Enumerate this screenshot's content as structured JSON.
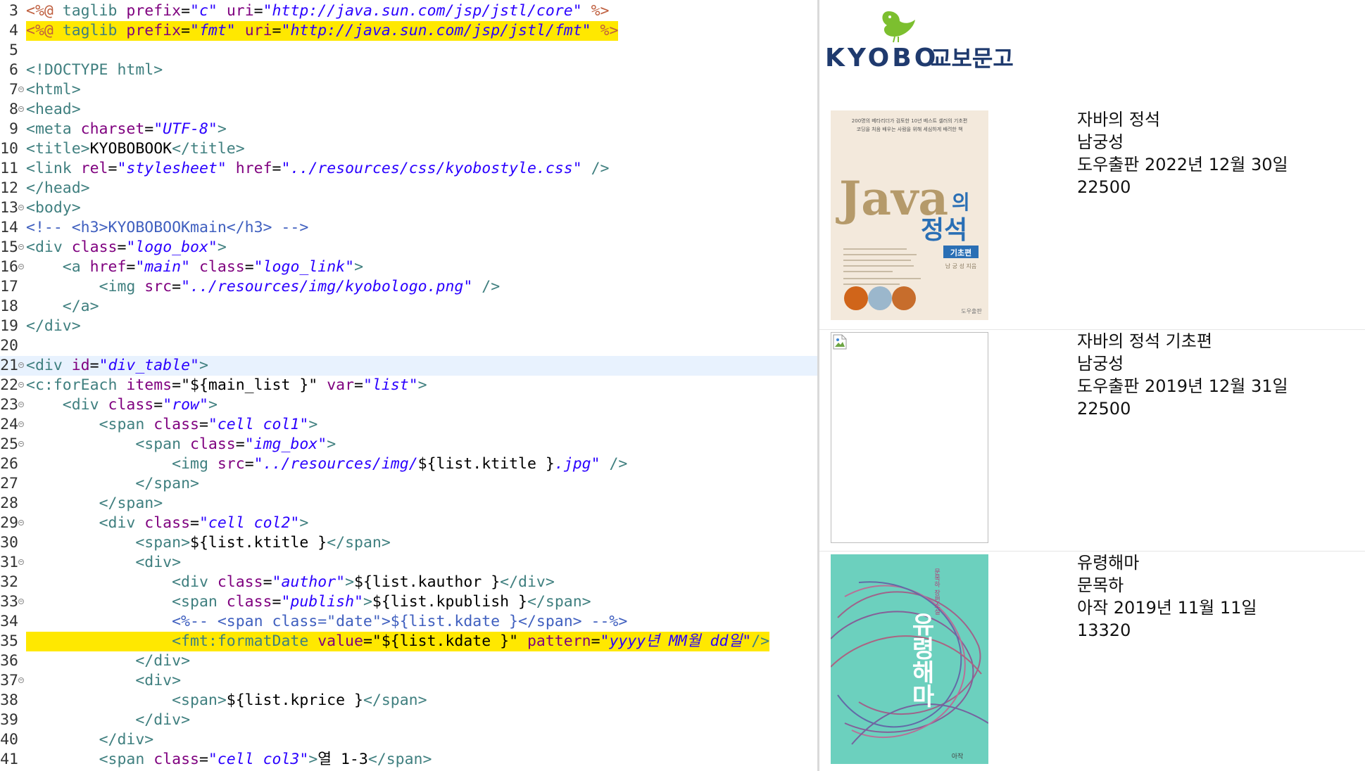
{
  "editor": {
    "current_line": 21,
    "lines": [
      {
        "n": "3",
        "fold": false,
        "hl": false,
        "tokens": [
          [
            "dir",
            "<%@ "
          ],
          [
            "tag",
            "taglib "
          ],
          [
            "attr",
            "prefix"
          ],
          [
            "txt",
            "="
          ],
          [
            "val",
            "\"c\""
          ],
          [
            "txt",
            " "
          ],
          [
            "attr",
            "uri"
          ],
          [
            "txt",
            "="
          ],
          [
            "val",
            "\"http://java.sun.com/jsp/jstl/core\""
          ],
          [
            "dir",
            " %>"
          ]
        ]
      },
      {
        "n": "4",
        "fold": false,
        "hl": true,
        "tokens": [
          [
            "dir",
            "<%@ "
          ],
          [
            "tag",
            "taglib "
          ],
          [
            "attr",
            "prefix"
          ],
          [
            "txt",
            "="
          ],
          [
            "val",
            "\"fmt\""
          ],
          [
            "txt",
            " "
          ],
          [
            "attr",
            "uri"
          ],
          [
            "txt",
            "="
          ],
          [
            "val",
            "\"http://java.sun.com/jsp/jstl/fmt\""
          ],
          [
            "dir",
            " %>"
          ]
        ]
      },
      {
        "n": "5",
        "fold": false,
        "hl": false,
        "tokens": []
      },
      {
        "n": "6",
        "fold": false,
        "hl": false,
        "tokens": [
          [
            "tag",
            "<!DOCTYPE "
          ],
          [
            "tag",
            "html"
          ],
          [
            "tag",
            ">"
          ]
        ]
      },
      {
        "n": "7",
        "fold": true,
        "hl": false,
        "tokens": [
          [
            "tag",
            "<html>"
          ]
        ]
      },
      {
        "n": "8",
        "fold": true,
        "hl": false,
        "tokens": [
          [
            "tag",
            "<head>"
          ]
        ]
      },
      {
        "n": "9",
        "fold": false,
        "hl": false,
        "tokens": [
          [
            "tag",
            "<meta "
          ],
          [
            "attr",
            "charset"
          ],
          [
            "txt",
            "="
          ],
          [
            "val",
            "\"UTF-8\""
          ],
          [
            "tag",
            ">"
          ]
        ]
      },
      {
        "n": "10",
        "fold": false,
        "hl": false,
        "tokens": [
          [
            "tag",
            "<title>"
          ],
          [
            "txt",
            "KYOBOBOOK"
          ],
          [
            "tag",
            "</title>"
          ]
        ]
      },
      {
        "n": "11",
        "fold": false,
        "hl": false,
        "tokens": [
          [
            "tag",
            "<link "
          ],
          [
            "attr",
            "rel"
          ],
          [
            "txt",
            "="
          ],
          [
            "val",
            "\"stylesheet\""
          ],
          [
            "txt",
            " "
          ],
          [
            "attr",
            "href"
          ],
          [
            "txt",
            "="
          ],
          [
            "val",
            "\"../resources/css/kyobostyle.css\""
          ],
          [
            "tag",
            " />"
          ]
        ]
      },
      {
        "n": "12",
        "fold": false,
        "hl": false,
        "tokens": [
          [
            "tag",
            "</head>"
          ]
        ]
      },
      {
        "n": "13",
        "fold": true,
        "hl": false,
        "tokens": [
          [
            "tag",
            "<body>"
          ]
        ]
      },
      {
        "n": "14",
        "fold": false,
        "hl": false,
        "tokens": [
          [
            "cmt",
            "<!-- <h3>KYOBOBOOKmain</h3> -->"
          ]
        ]
      },
      {
        "n": "15",
        "fold": true,
        "hl": false,
        "tokens": [
          [
            "tag",
            "<div "
          ],
          [
            "attr",
            "class"
          ],
          [
            "txt",
            "="
          ],
          [
            "val",
            "\"logo_box\""
          ],
          [
            "tag",
            ">"
          ]
        ]
      },
      {
        "n": "16",
        "fold": true,
        "hl": false,
        "tokens": [
          [
            "txt",
            "    "
          ],
          [
            "tag",
            "<a "
          ],
          [
            "attr",
            "href"
          ],
          [
            "txt",
            "="
          ],
          [
            "val",
            "\"main\""
          ],
          [
            "txt",
            " "
          ],
          [
            "attr",
            "class"
          ],
          [
            "txt",
            "="
          ],
          [
            "val",
            "\"logo_link\""
          ],
          [
            "tag",
            ">"
          ]
        ]
      },
      {
        "n": "17",
        "fold": false,
        "hl": false,
        "tokens": [
          [
            "txt",
            "        "
          ],
          [
            "tag",
            "<img "
          ],
          [
            "attr",
            "src"
          ],
          [
            "txt",
            "="
          ],
          [
            "val",
            "\"../resources/img/kyobologo.png\""
          ],
          [
            "tag",
            " />"
          ]
        ]
      },
      {
        "n": "18",
        "fold": false,
        "hl": false,
        "tokens": [
          [
            "txt",
            "    "
          ],
          [
            "tag",
            "</a>"
          ]
        ]
      },
      {
        "n": "19",
        "fold": false,
        "hl": false,
        "tokens": [
          [
            "tag",
            "</div>"
          ]
        ]
      },
      {
        "n": "20",
        "fold": false,
        "hl": false,
        "tokens": []
      },
      {
        "n": "21",
        "fold": true,
        "hl": false,
        "tokens": [
          [
            "tag",
            "<div "
          ],
          [
            "attr",
            "id"
          ],
          [
            "txt",
            "="
          ],
          [
            "val",
            "\"div_table\""
          ],
          [
            "tag",
            ">"
          ]
        ]
      },
      {
        "n": "22",
        "fold": true,
        "hl": false,
        "tokens": [
          [
            "tag",
            "<c:forEach "
          ],
          [
            "attr",
            "items"
          ],
          [
            "txt",
            "="
          ],
          [
            "txt",
            "\"${main_list }\""
          ],
          [
            "txt",
            " "
          ],
          [
            "attr",
            "var"
          ],
          [
            "txt",
            "="
          ],
          [
            "val",
            "\"list\""
          ],
          [
            "tag",
            ">"
          ]
        ]
      },
      {
        "n": "23",
        "fold": true,
        "hl": false,
        "tokens": [
          [
            "txt",
            "    "
          ],
          [
            "tag",
            "<div "
          ],
          [
            "attr",
            "class"
          ],
          [
            "txt",
            "="
          ],
          [
            "val",
            "\"row\""
          ],
          [
            "tag",
            ">"
          ]
        ]
      },
      {
        "n": "24",
        "fold": true,
        "hl": false,
        "tokens": [
          [
            "txt",
            "        "
          ],
          [
            "tag",
            "<span "
          ],
          [
            "attr",
            "class"
          ],
          [
            "txt",
            "="
          ],
          [
            "val",
            "\"cell col1\""
          ],
          [
            "tag",
            ">"
          ]
        ]
      },
      {
        "n": "25",
        "fold": true,
        "hl": false,
        "tokens": [
          [
            "txt",
            "            "
          ],
          [
            "tag",
            "<span "
          ],
          [
            "attr",
            "class"
          ],
          [
            "txt",
            "="
          ],
          [
            "val",
            "\"img_box\""
          ],
          [
            "tag",
            ">"
          ]
        ]
      },
      {
        "n": "26",
        "fold": false,
        "hl": false,
        "tokens": [
          [
            "txt",
            "                "
          ],
          [
            "tag",
            "<img "
          ],
          [
            "attr",
            "src"
          ],
          [
            "txt",
            "="
          ],
          [
            "val",
            "\"../resources/img/"
          ],
          [
            "txt",
            "${list.ktitle }"
          ],
          [
            "val",
            ".jpg\""
          ],
          [
            "tag",
            " />"
          ]
        ]
      },
      {
        "n": "27",
        "fold": false,
        "hl": false,
        "tokens": [
          [
            "txt",
            "            "
          ],
          [
            "tag",
            "</span>"
          ]
        ]
      },
      {
        "n": "28",
        "fold": false,
        "hl": false,
        "tokens": [
          [
            "txt",
            "        "
          ],
          [
            "tag",
            "</span>"
          ]
        ]
      },
      {
        "n": "29",
        "fold": true,
        "hl": false,
        "tokens": [
          [
            "txt",
            "        "
          ],
          [
            "tag",
            "<div "
          ],
          [
            "attr",
            "class"
          ],
          [
            "txt",
            "="
          ],
          [
            "val",
            "\"cell col2\""
          ],
          [
            "tag",
            ">"
          ]
        ]
      },
      {
        "n": "30",
        "fold": false,
        "hl": false,
        "tokens": [
          [
            "txt",
            "            "
          ],
          [
            "tag",
            "<span>"
          ],
          [
            "txt",
            "${list.ktitle }"
          ],
          [
            "tag",
            "</span>"
          ]
        ]
      },
      {
        "n": "31",
        "fold": true,
        "hl": false,
        "tokens": [
          [
            "txt",
            "            "
          ],
          [
            "tag",
            "<div>"
          ]
        ]
      },
      {
        "n": "32",
        "fold": false,
        "hl": false,
        "tokens": [
          [
            "txt",
            "                "
          ],
          [
            "tag",
            "<div "
          ],
          [
            "attr",
            "class"
          ],
          [
            "txt",
            "="
          ],
          [
            "val",
            "\"author\""
          ],
          [
            "tag",
            ">"
          ],
          [
            "txt",
            "${list.kauthor }"
          ],
          [
            "tag",
            "</div>"
          ]
        ]
      },
      {
        "n": "33",
        "fold": true,
        "hl": false,
        "tokens": [
          [
            "txt",
            "                "
          ],
          [
            "tag",
            "<span "
          ],
          [
            "attr",
            "class"
          ],
          [
            "txt",
            "="
          ],
          [
            "val",
            "\"publish\""
          ],
          [
            "tag",
            ">"
          ],
          [
            "txt",
            "${list.kpublish }"
          ],
          [
            "tag",
            "</span>"
          ]
        ]
      },
      {
        "n": "34",
        "fold": false,
        "hl": false,
        "tokens": [
          [
            "txt",
            "                "
          ],
          [
            "cmt",
            "<%-- <span class=\"date\">${list.kdate }</span> --%>"
          ]
        ]
      },
      {
        "n": "35",
        "fold": false,
        "hl": true,
        "tokens": [
          [
            "txt",
            "                "
          ],
          [
            "tag",
            "<fmt:formatDate "
          ],
          [
            "attr",
            "value"
          ],
          [
            "txt",
            "="
          ],
          [
            "txt",
            "\"${list.kdate }\""
          ],
          [
            "txt",
            " "
          ],
          [
            "attr",
            "pattern"
          ],
          [
            "txt",
            "="
          ],
          [
            "val",
            "\"yyyy년 MM월 dd일\""
          ],
          [
            "tag",
            "/>"
          ]
        ]
      },
      {
        "n": "36",
        "fold": false,
        "hl": false,
        "tokens": [
          [
            "txt",
            "            "
          ],
          [
            "tag",
            "</div>"
          ]
        ]
      },
      {
        "n": "37",
        "fold": true,
        "hl": false,
        "tokens": [
          [
            "txt",
            "            "
          ],
          [
            "tag",
            "<div>"
          ]
        ]
      },
      {
        "n": "38",
        "fold": false,
        "hl": false,
        "tokens": [
          [
            "txt",
            "                "
          ],
          [
            "tag",
            "<span>"
          ],
          [
            "txt",
            "${list.kprice }"
          ],
          [
            "tag",
            "</span>"
          ]
        ]
      },
      {
        "n": "39",
        "fold": false,
        "hl": false,
        "tokens": [
          [
            "txt",
            "            "
          ],
          [
            "tag",
            "</div>"
          ]
        ]
      },
      {
        "n": "40",
        "fold": false,
        "hl": false,
        "tokens": [
          [
            "txt",
            "        "
          ],
          [
            "tag",
            "</div>"
          ]
        ]
      },
      {
        "n": "41",
        "fold": false,
        "hl": false,
        "tokens": [
          [
            "txt",
            "        "
          ],
          [
            "tag",
            "<span "
          ],
          [
            "attr",
            "class"
          ],
          [
            "txt",
            "="
          ],
          [
            "val",
            "\"cell col3\""
          ],
          [
            "tag",
            ">"
          ],
          [
            "txt",
            "열 1-3"
          ],
          [
            "tag",
            "</span>"
          ]
        ]
      }
    ]
  },
  "browser": {
    "logo": {
      "wordmark": "KYOBO",
      "korean": "교보문고",
      "bird_color": "#7cbf2f",
      "text_color": "#1f3a6e"
    },
    "books": [
      {
        "title": "자바의 정석",
        "author": "남궁성",
        "publish_date": "도우출판 2022년 12월 30일",
        "price": "22500",
        "cover": {
          "type": "image",
          "bg": "#f3e9dc",
          "blurb_1": "200명의 베타리더가 검토한 10년 베스트 셀러의 기초편",
          "blurb_2": "코딩을 처음 배우는 사람을 위해 세심하게 배려한 책",
          "big": "Java",
          "ui": "의",
          "jeongseok": "정석",
          "edition": "기초편",
          "author_line": "남 궁 성 지음",
          "publisher": "도우출판"
        }
      },
      {
        "title": "자바의 정석 기초편",
        "author": "남궁성",
        "publish_date": "도우출판 2019년 12월 31일",
        "price": "22500",
        "cover": {
          "type": "broken"
        }
      },
      {
        "title": "유령해마",
        "author": "문목하",
        "publish_date": "아작 2019년 11월 11일",
        "price": "13320",
        "cover": {
          "type": "image",
          "bg": "#6cd0be",
          "title_v": "유령해마",
          "sub_v": "문목하 장편소설",
          "publisher": "아작"
        }
      }
    ]
  }
}
